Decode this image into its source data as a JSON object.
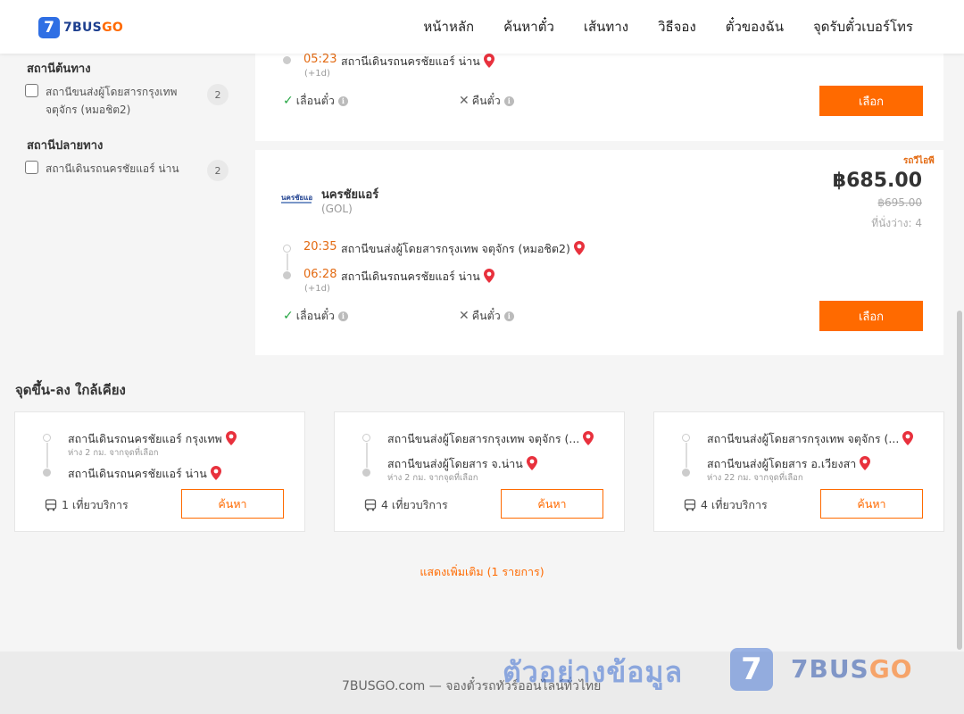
{
  "header": {
    "logo_mark": "7",
    "logo_text_main": "7BUS",
    "logo_text_accent": "GO",
    "nav": [
      "หน้าหลัก",
      "ค้นหาตั๋ว",
      "เส้นทาง",
      "วิธีจอง",
      "ตั๋วของฉัน",
      "จุดรับตั๋วเบอร์โทร"
    ]
  },
  "sidebar": {
    "origin_title": "สถานีต้นทาง",
    "origin_items": [
      {
        "label": "สถานีขนส่งผู้โดยสารกรุงเทพ จตุจักร (หมอชิต2)",
        "count": "2"
      }
    ],
    "dest_title": "สถานีปลายทาง",
    "dest_items": [
      {
        "label": "สถานีเดินรถนครชัยแอร์ น่าน",
        "count": "2"
      }
    ]
  },
  "trips": [
    {
      "arrive_time": "05:23",
      "arrive_station": "สถานีเดินรถนครชัยแอร์ น่าน",
      "next_day": "(+1d)",
      "change_label": "เลื่อนตั๋ว",
      "refund_label": "คืนตั๋ว",
      "select_label": "เลือก"
    },
    {
      "badge": "รถวีไอพี",
      "operator": "นครชัยแอร์",
      "operator_code": "(GOL)",
      "price": "฿685.00",
      "old_price": "฿695.00",
      "seats": "ที่นั่งว่าง: 4",
      "depart_time": "20:35",
      "depart_station": "สถานีขนส่งผู้โดยสารกรุงเทพ จตุจักร (หมอชิต2)",
      "arrive_time": "06:28",
      "arrive_station": "สถานีเดินรถนครชัยแอร์ น่าน",
      "next_day": "(+1d)",
      "change_label": "เลื่อนตั๋ว",
      "refund_label": "คืนตั๋ว",
      "select_label": "เลือก"
    }
  ],
  "nearby": {
    "title": "จุดขึ้น-ลง ใกล้เคียง",
    "items": [
      {
        "from": "สถานีเดินรถนครชัยแอร์ กรุงเทพ",
        "from_dist": "ห่าง 2 กม. จากจุดที่เลือก",
        "to": "สถานีเดินรถนครชัยแอร์ น่าน",
        "to_dist": "",
        "trips": "1 เที่ยวบริการ",
        "search": "ค้นหา"
      },
      {
        "from": "สถานีขนส่งผู้โดยสารกรุงเทพ จตุจักร (...",
        "from_dist": "",
        "to": "สถานีขนส่งผู้โดยสาร จ.น่าน",
        "to_dist": "ห่าง 2 กม. จากจุดที่เลือก",
        "trips": "4 เที่ยวบริการ",
        "search": "ค้นหา"
      },
      {
        "from": "สถานีขนส่งผู้โดยสารกรุงเทพ จตุจักร (...",
        "from_dist": "",
        "to": "สถานีขนส่งผู้โดยสาร อ.เวียงสา",
        "to_dist": "ห่าง 22 กม. จากจุดที่เลือก",
        "trips": "4 เที่ยวบริการ",
        "search": "ค้นหา"
      }
    ],
    "more": "แสดงเพิ่มเติม (1 รายการ)"
  },
  "footer": {
    "text": "7BUSGO.com — จองตั๋วรถทัวร์ออนไลน์ทั่วไทย",
    "watermark": "ตัวอย่างข้อมูล",
    "wm_mark": "7",
    "wm_main": "7BUS",
    "wm_accent": "GO"
  },
  "colors": {
    "accent": "#ff6a00",
    "brand": "#2f6fe4",
    "time": "#e36a12",
    "check": "#28a745"
  }
}
